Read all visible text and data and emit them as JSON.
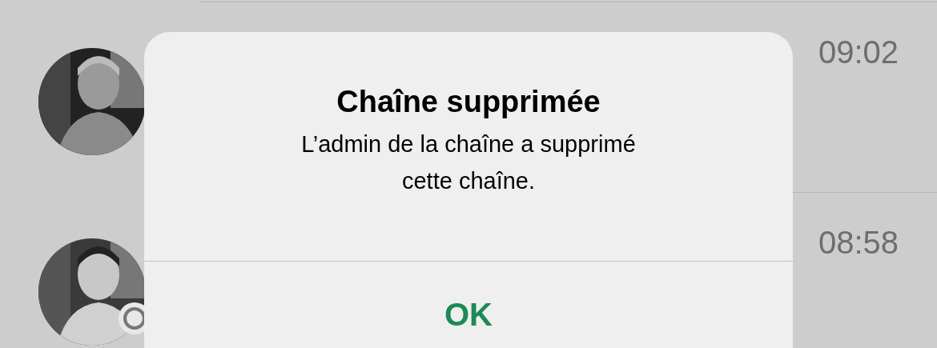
{
  "chats": [
    {
      "time": "09:02",
      "badge": false
    },
    {
      "time": "08:58",
      "badge": true
    }
  ],
  "alert": {
    "title": "Chaîne supprimée",
    "message": "L’admin de la chaîne a supprimé cette chaîne.",
    "button": "OK"
  }
}
